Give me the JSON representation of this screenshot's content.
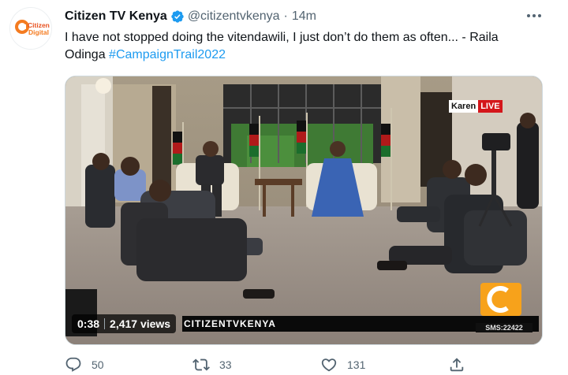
{
  "tweet": {
    "author": {
      "display_name": "Citizen TV Kenya",
      "handle": "@citizentvkenya",
      "avatar_logo_text": [
        "Citizen",
        "Digital"
      ]
    },
    "dot": "·",
    "time": "14m",
    "text": {
      "body": "I have not stopped doing the vitendawili, I just don’t do them as often... - Raila Odinga ",
      "hashtag": "#CampaignTrail2022"
    },
    "colors": {
      "accent": "#1d9bf0",
      "muted": "#536471",
      "live_red": "#d4161b",
      "verified": "#1d9bf0"
    },
    "media": {
      "type": "video",
      "duration": "0:38",
      "views": "2,417 views",
      "overlay": {
        "location": "Karen",
        "live_badge": "LIVE",
        "ticker": "CITIZENTVKENYA",
        "sms": "SMS:22422"
      }
    },
    "actions": {
      "reply_count": "50",
      "retweet_count": "33",
      "like_count": "131",
      "icons": [
        "reply-icon",
        "retweet-icon",
        "like-icon",
        "share-icon"
      ]
    }
  }
}
